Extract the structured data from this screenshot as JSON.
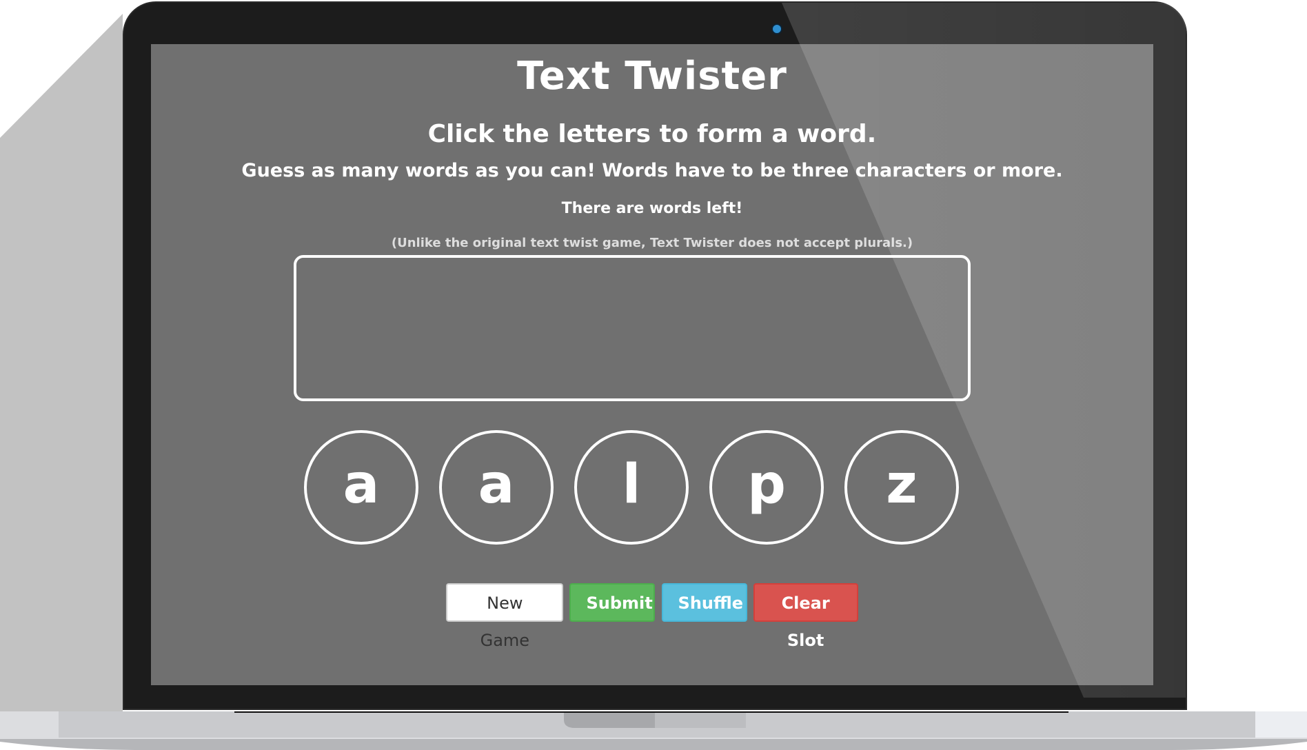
{
  "game": {
    "title": "Text Twister",
    "subtitle": "Click the letters to form a word.",
    "rules": "Guess as many words as you can! Words have to be three characters or more.",
    "words_left": "There are words left!",
    "note": "(Unlike the original text twist game, Text Twister does not accept plurals.)",
    "letters": [
      "a",
      "a",
      "l",
      "p",
      "z"
    ],
    "buttons": {
      "new_game": "New Game",
      "submit": "Submit",
      "shuffle": "Shuffle",
      "clear_slot": "Clear Slot"
    }
  },
  "device": {
    "camera_icon": "webcam-icon"
  },
  "colors": {
    "screen_bg": "#707070",
    "submit": "#5cb85c",
    "shuffle": "#5bc0de",
    "clear": "#d9534f"
  }
}
